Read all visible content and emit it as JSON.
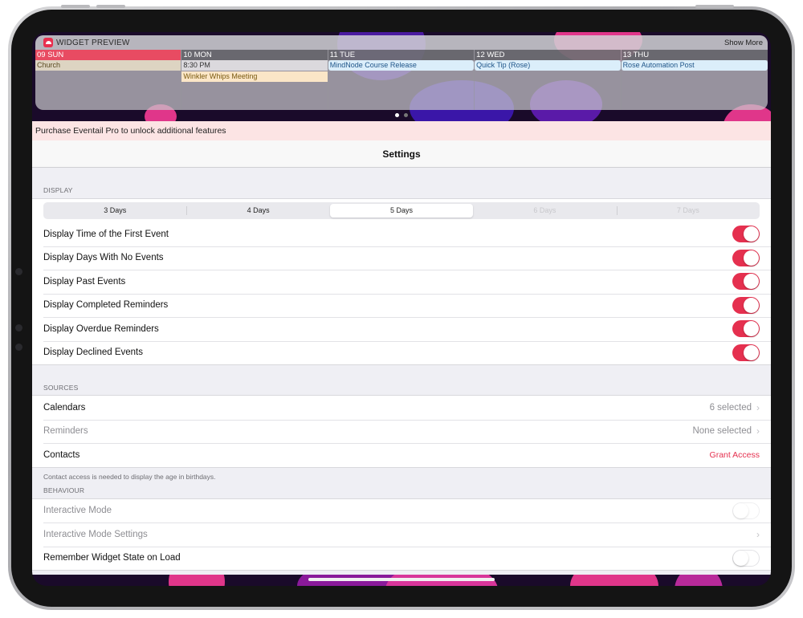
{
  "colors": {
    "accent": "#e5304f",
    "today_header": "#e84b62",
    "promo_bg": "#fce4e4"
  },
  "widget": {
    "title": "WIDGET PREVIEW",
    "icon": "calendar-app-icon",
    "show_more": "Show More",
    "days": [
      {
        "header": "09 SUN",
        "today": true,
        "events": [
          {
            "text": "Church",
            "style": "church"
          }
        ]
      },
      {
        "header": "10 MON",
        "today": false,
        "events": [
          {
            "text": "8:30 PM",
            "style": "time"
          },
          {
            "text": "Winkler Whips Meeting",
            "style": "meeting"
          }
        ]
      },
      {
        "header": "11 TUE",
        "today": false,
        "events": [
          {
            "text": "MindNode Course Release",
            "style": "blue"
          }
        ]
      },
      {
        "header": "12 WED",
        "today": false,
        "events": [
          {
            "text": "Quick Tip (Rose)",
            "style": "blue"
          }
        ]
      },
      {
        "header": "13 THU",
        "today": false,
        "events": [
          {
            "text": "Rose Automation Post",
            "style": "blue"
          }
        ]
      }
    ]
  },
  "promo": "Purchase Eventail Pro to unlock additional features",
  "nav": {
    "title": "Settings"
  },
  "display": {
    "label": "DISPLAY",
    "segments": [
      "3 Days",
      "4 Days",
      "5 Days",
      "6 Days",
      "7 Days"
    ],
    "selected_segment": "5 Days",
    "rows": [
      {
        "label": "Display Time of the First Event",
        "on": true
      },
      {
        "label": "Display Days With No Events",
        "on": true
      },
      {
        "label": "Display Past Events",
        "on": true
      },
      {
        "label": "Display Completed Reminders",
        "on": true
      },
      {
        "label": "Display Overdue Reminders",
        "on": true
      },
      {
        "label": "Display Declined Events",
        "on": true
      }
    ]
  },
  "sources": {
    "label": "SOURCES",
    "calendars": {
      "label": "Calendars",
      "value": "6 selected"
    },
    "reminders": {
      "label": "Reminders",
      "value": "None selected"
    },
    "contacts": {
      "label": "Contacts",
      "action": "Grant Access"
    },
    "footnote": "Contact access is needed to display the age in birthdays."
  },
  "behaviour": {
    "label": "BEHAVIOUR",
    "interactive_mode": {
      "label": "Interactive Mode",
      "on": false
    },
    "interactive_mode_settings": {
      "label": "Interactive Mode Settings"
    },
    "remember_state": {
      "label": "Remember Widget State on Load",
      "on": false
    }
  }
}
